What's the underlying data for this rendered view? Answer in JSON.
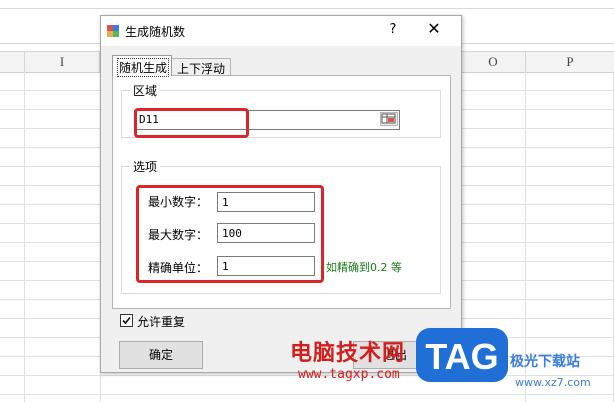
{
  "spreadsheet": {
    "columns": [
      "I",
      "O",
      "P"
    ]
  },
  "dialog": {
    "title": "生成随机数",
    "help": "?",
    "close": "✕",
    "tabs": [
      {
        "label": "随机生成",
        "active": true
      },
      {
        "label": "上下浮动",
        "active": false
      }
    ],
    "region": {
      "group_label": "区域",
      "value": "D11"
    },
    "options": {
      "group_label": "选项",
      "min_label": "最小数字：",
      "min_value": "1",
      "max_label": "最大数字：",
      "max_value": "100",
      "step_label": "精确单位：",
      "step_value": "1",
      "hint": "如精确到0.2 等"
    },
    "allow_repeat": {
      "label": "允许重复",
      "checked": true
    },
    "ok_label": "确定",
    "exit_label": "退出"
  },
  "watermark": {
    "site_name": "电脑技术网",
    "url": "www.tagxp.com",
    "logo": "TAG",
    "site2": "极光下载站",
    "site2_url": "www.xz7.com"
  },
  "colors": {
    "highlight": "#d8262b",
    "hint_green": "#1a7a1a",
    "watermark_red": "#d31e1e",
    "tag_blue": "#1f6fd6"
  }
}
